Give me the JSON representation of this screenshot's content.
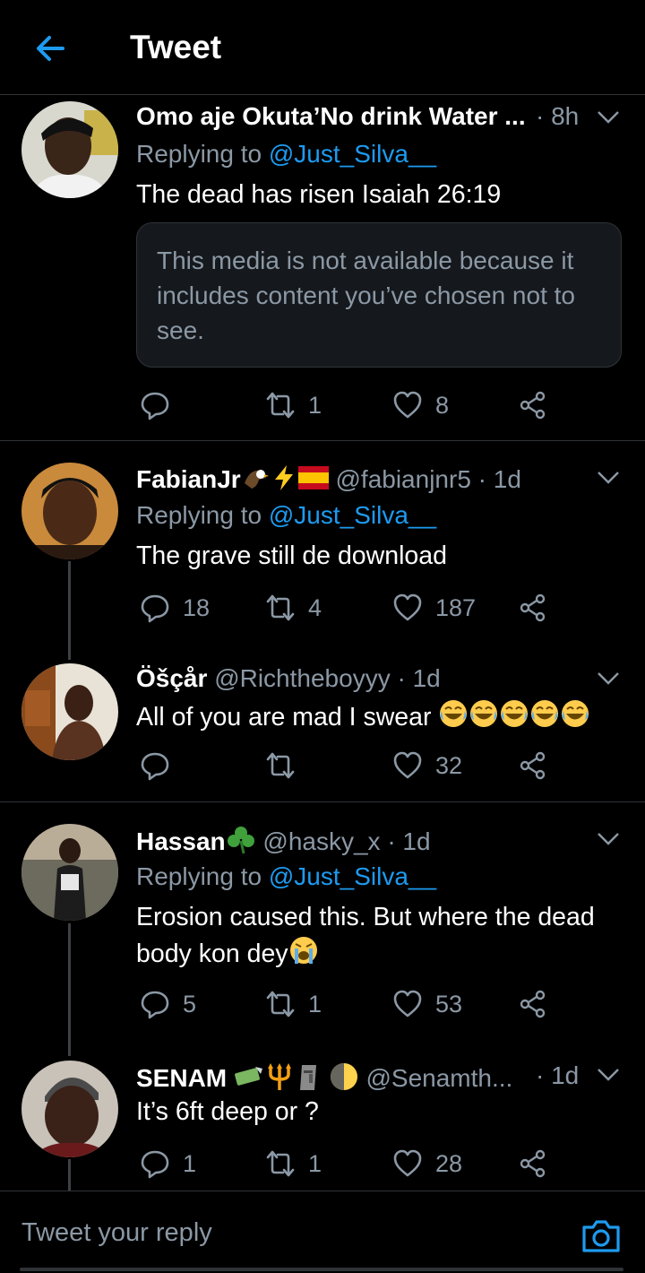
{
  "header": {
    "title": "Tweet"
  },
  "colors": {
    "accent": "#1d9bf0",
    "muted": "#8b98a5",
    "border": "#2f3336",
    "background": "#000000"
  },
  "tweets": [
    {
      "name": "Omo aje Okuta’No drink Water ...",
      "handle": "",
      "time": "· 8h",
      "replying_prefix": "Replying to ",
      "replying_to": "@Just_Silva__",
      "text": "The dead has risen Isaiah 26:19",
      "media_note": "This media is not available because it includes content you’ve chosen not to see.",
      "replies": "",
      "retweets": "1",
      "likes": "8"
    },
    {
      "name": "FabianJr",
      "name_emojis": [
        "eagle-emoji",
        "lightning-emoji",
        "spain-flag-emoji"
      ],
      "handle": "@fabianjnr5",
      "time": "· 1d",
      "replying_prefix": "Replying to ",
      "replying_to": "@Just_Silva__",
      "text": "The grave still de download",
      "replies": "18",
      "retweets": "4",
      "likes": "187"
    },
    {
      "name": "Öšçår",
      "handle": "@Richtheboyyy",
      "time": "· 1d",
      "text": "All of you are mad I swear",
      "text_emojis": [
        "laughing-emoji",
        "laughing-emoji",
        "laughing-emoji",
        "laughing-emoji",
        "laughing-emoji"
      ],
      "replies": "",
      "retweets": "",
      "likes": "32"
    },
    {
      "name": "Hassan",
      "name_emojis": [
        "shamrock-emoji"
      ],
      "handle": "@hasky_x",
      "time": "· 1d",
      "replying_prefix": "Replying to ",
      "replying_to": "@Just_Silva__",
      "text_line1": "Erosion caused this. But where the dead",
      "text_line2": "body kon dey",
      "text_emojis": [
        "crying-emoji"
      ],
      "replies": "5",
      "retweets": "1",
      "likes": "53"
    },
    {
      "name": "SENAM",
      "name_emojis": [
        "money-emoji",
        "trident-emoji",
        "moai-emoji",
        "moon-emoji"
      ],
      "handle": "@Senamth...",
      "time": "· 1d",
      "text": "It’s 6ft deep or ?",
      "replies": "1",
      "retweets": "1",
      "likes": "28"
    }
  ],
  "reply_bar": {
    "placeholder": "Tweet your reply"
  }
}
